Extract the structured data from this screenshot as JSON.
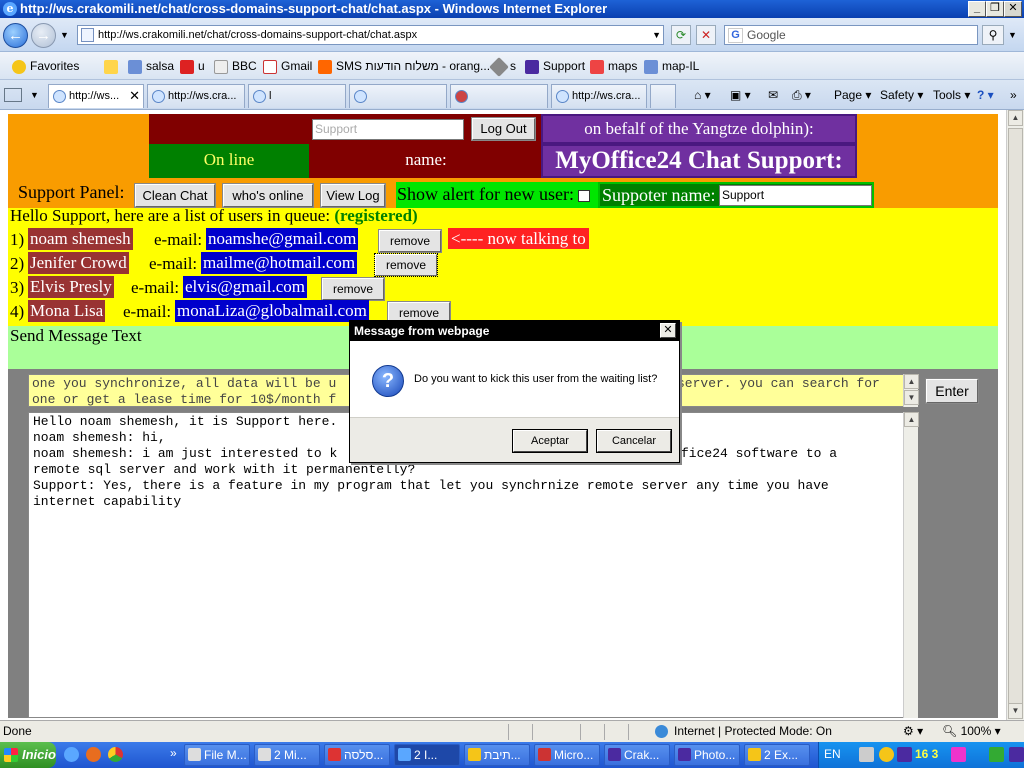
{
  "window": {
    "title": "http://ws.crakomili.net/chat/cross-domains-support-chat/chat.aspx - Windows Internet Explorer"
  },
  "address": {
    "url": "http://ws.crakomili.net/chat/cross-domains-support-chat/chat.aspx",
    "search_placeholder": "Google"
  },
  "favorites": {
    "label": "Favorites",
    "items": [
      "salsa",
      "u",
      "BBC",
      "Gmail",
      "SMS משלוח הודעות - orang...",
      "s",
      "Support",
      "maps",
      "map-IL"
    ]
  },
  "tabs": [
    {
      "label": "http://ws...",
      "active": true
    },
    {
      "label": "http://ws.cra...",
      "active": false
    },
    {
      "label": "l",
      "active": false
    },
    {
      "label": "",
      "active": false
    },
    {
      "label": "",
      "active": false
    },
    {
      "label": "http://ws.cra...",
      "active": false
    },
    {
      "label": "",
      "active": false
    }
  ],
  "commands": {
    "page": "Page",
    "safety": "Safety",
    "tools": "Tools"
  },
  "app": {
    "support_input": "Support",
    "logout": "Log Out",
    "behalf": "on befalf of the Yangtze dolphin):",
    "online": "On line",
    "name_label": "name:",
    "brand": "MyOffice24 Chat Support:",
    "panel_label": "Support Panel:",
    "clean_chat": "Clean Chat",
    "whos_online": "who's online",
    "view_log": "View Log",
    "alert_label": "Show alert for new user:",
    "supporter_label": "Suppoter name:",
    "supporter_value": "Support",
    "queue_intro": "Hello Support, here are a list of users in queue:",
    "queue_status": "(registered)",
    "email_label": "e-mail:",
    "remove_label": "remove",
    "talking": "<---- now talking to",
    "users": [
      {
        "idx": "1)",
        "name": "noam shemesh",
        "email": "noamshe@gmail.com"
      },
      {
        "idx": "2)",
        "name": "Jenifer Crowd",
        "email": "mailme@hotmail.com"
      },
      {
        "idx": "3)",
        "name": "Elvis Presly",
        "email": "elvis@gmail.com"
      },
      {
        "idx": "4)",
        "name": "Mona Lisa",
        "email": "monaLiza@globalmail.com"
      }
    ],
    "send_label": "Send Message Text",
    "message_text_1": "one you synchronize, all data will be u",
    "message_text_1b": "server. you can search for",
    "message_text_2": "one or get a lease time for 10$/month f",
    "enter": "Enter",
    "chat_lines": [
      "Hello noam shemesh, it is Support here.",
      "noam shemesh: hi,",
      "noam shemesh: i am just interested to k",
      "remote sql server and work with it permanentelly?",
      "Support: Yes, there is a feature in my program that let you synchrnize remote server any time you have",
      "internet capability"
    ],
    "chat_line3_tail": "fice24 software to a"
  },
  "dialog": {
    "title": "Message from webpage",
    "message": "Do you want to kick this user from the waiting list?",
    "ok": "Aceptar",
    "cancel": "Cancelar"
  },
  "status": {
    "left": "Done",
    "zone": "Internet | Protected Mode: On",
    "zoom": "100%"
  },
  "taskbar": {
    "start": "Inicio",
    "items": [
      "File M...",
      "2 Mi...",
      "סלסה...",
      "2 I...",
      "תיבת...",
      "Micro...",
      "Crak...",
      "Photo...",
      "2 Ex..."
    ],
    "lang": "EN",
    "tray_text": "16 3"
  },
  "colors": {
    "page_bg": "#f99c00",
    "queue_bg": "#ffff00",
    "send_bg": "#aaff99",
    "chat_bg": "#808080"
  }
}
